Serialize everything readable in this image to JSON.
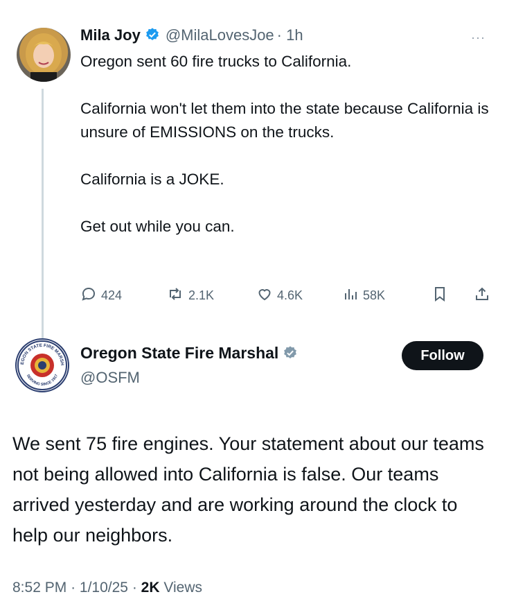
{
  "tweet1": {
    "author_name": "Mila Joy",
    "handle": "@MilaLovesJoe",
    "time": "· 1h",
    "more_label": "···",
    "text": "Oregon sent 60 fire trucks to California.\n\nCalifornia won't let them into the state because California is unsure of EMISSIONS on the trucks.\n\nCalifornia is a JOKE.\n\nGet out while you can.",
    "replies": "424",
    "reposts": "2.1K",
    "likes": "4.6K",
    "views": "58K"
  },
  "tweet2": {
    "author_name": "Oregon State Fire Marshal",
    "handle": "@OSFM",
    "follow_label": "Follow",
    "text": "We sent 75 fire engines. Your statement about our teams not being allowed into California is false. Our teams arrived yesterday and are working around the clock to help our neighbors.",
    "time": "8:52 PM",
    "date": "1/10/25",
    "views_count": "2K",
    "views_label": "Views",
    "logo_text": "OREGON STATE FIRE MARSHAL",
    "logo_sub": "SERVING SINCE 1917"
  },
  "colors": {
    "verified_blue": "#1d9bf0",
    "verified_gray": "#829aab",
    "text": "#0f1419",
    "muted": "#536471"
  }
}
